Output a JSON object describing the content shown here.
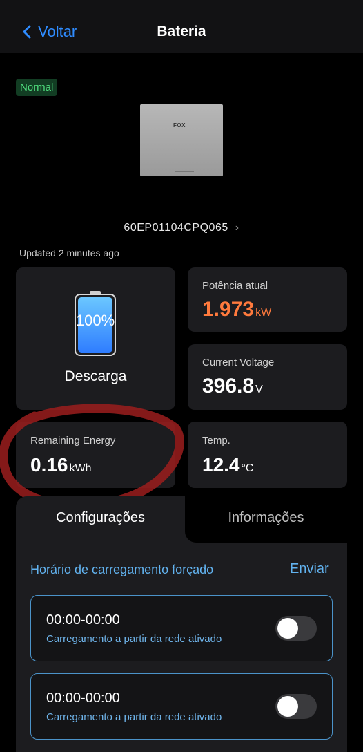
{
  "header": {
    "back_label": "Voltar",
    "title": "Bateria"
  },
  "status_badge": "Normal",
  "device_logo": "FOX",
  "serial": "60EP01104CPQ065",
  "updated": "Updated 2 minutes ago",
  "battery": {
    "percent_label": "100%",
    "level": 1.0,
    "state": "Descarga"
  },
  "power": {
    "label": "Potência atual",
    "value": "1.973",
    "unit": "kW",
    "color": "#ff7a3d"
  },
  "voltage": {
    "label": "Current Voltage",
    "value": "396.8",
    "unit": "V"
  },
  "remaining": {
    "label": "Remaining Energy",
    "value": "0.16",
    "unit": "kWh"
  },
  "temp": {
    "label": "Temp.",
    "value": "12.4",
    "unit": "°C"
  },
  "tabs": {
    "active": "Configurações",
    "inactive": "Informações"
  },
  "section": {
    "title": "Horário de carregamento forçado",
    "action": "Enviar"
  },
  "schedules": [
    {
      "time": "00:00-00:00",
      "desc": "Carregamento a partir da rede ativado",
      "enabled": false
    },
    {
      "time": "00:00-00:00",
      "desc": "Carregamento a partir da rede ativado",
      "enabled": false
    }
  ],
  "colors": {
    "accent": "#2f8cff",
    "badge_bg": "#123d23",
    "badge_text": "#4fdc7d",
    "annotation": "#9b1d1d"
  }
}
